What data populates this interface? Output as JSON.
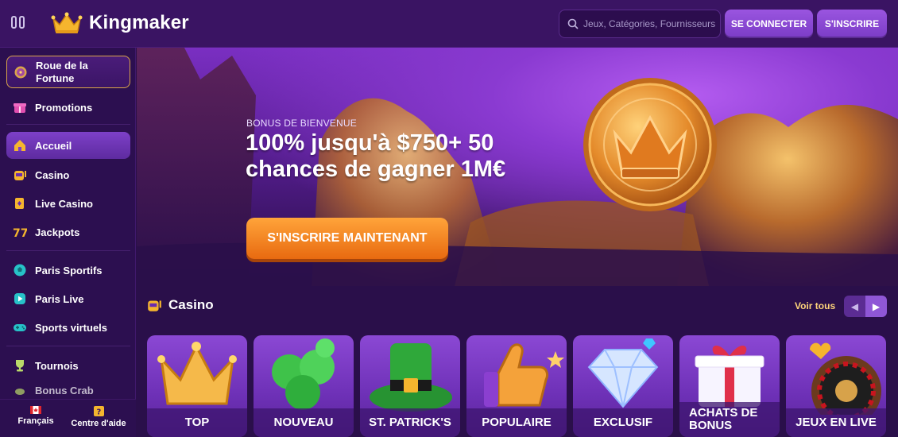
{
  "header": {
    "brand": "Kingmaker",
    "search_placeholder": "Jeux, Catégories, Fournisseurs",
    "login_label": "SE CONNECTER",
    "signup_label": "S'INSCRIRE"
  },
  "sidebar": {
    "items": [
      {
        "label": "Roue de la Fortune",
        "icon": "wheel-icon"
      },
      {
        "label": "Promotions",
        "icon": "gift-icon"
      },
      {
        "label": "Accueil",
        "icon": "home-icon"
      },
      {
        "label": "Casino",
        "icon": "casino-icon"
      },
      {
        "label": "Live Casino",
        "icon": "cards-icon"
      },
      {
        "label": "Jackpots",
        "icon": "jackpot-icon"
      },
      {
        "label": "Paris Sportifs",
        "icon": "soccer-ball-icon"
      },
      {
        "label": "Paris Live",
        "icon": "live-play-icon"
      },
      {
        "label": "Sports virtuels",
        "icon": "gamepad-icon"
      },
      {
        "label": "Tournois",
        "icon": "trophy-icon"
      },
      {
        "label": "Bonus Crab",
        "icon": "crab-icon"
      }
    ],
    "footer": {
      "language": "Français",
      "help": "Centre d'aide"
    }
  },
  "hero": {
    "label": "BONUS DE BIENVENUE",
    "title": "100% jusqu'à $750+ 50 chances de gagner 1M€",
    "cta": "S'INSCRIRE MAINTENANT"
  },
  "casino": {
    "title": "Casino",
    "see_all": "Voir tous",
    "tiles": [
      "TOP",
      "NOUVEAU",
      "ST. PATRICK'S",
      "POPULAIRE",
      "EXCLUSIF",
      "ACHATS DE BONUS",
      "JEUX EN LIVE"
    ]
  },
  "colors": {
    "accent": "#8f57d6",
    "cta": "#f08a1f",
    "background": "#2a0f4a",
    "gold": "#f3b13a"
  }
}
